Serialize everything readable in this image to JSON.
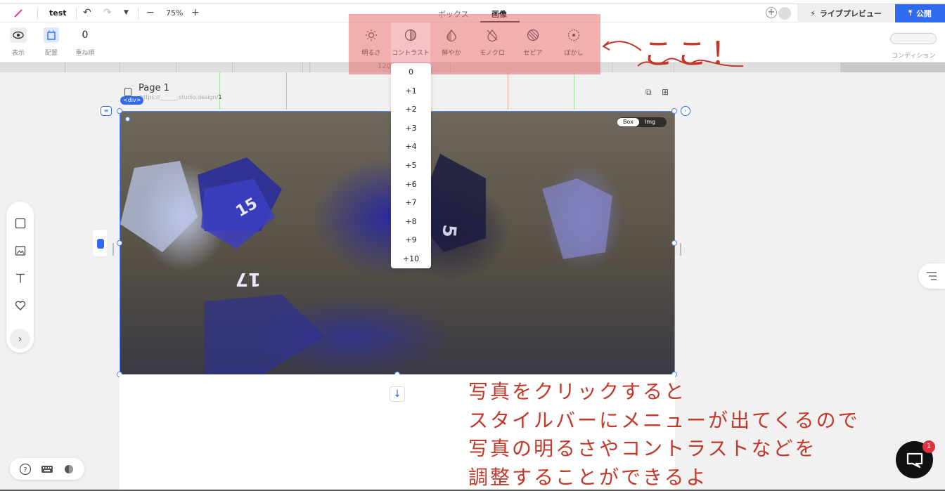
{
  "topbar": {
    "project_name": "test",
    "zoom": "75%",
    "tabs": [
      {
        "label": "ボックス",
        "active": false
      },
      {
        "label": "画像",
        "active": true
      }
    ],
    "live_preview_label": "ライブプレビュー",
    "publish_label": "公開",
    "publish_color": "#2f6bef"
  },
  "stylebar": {
    "visibility_label": "表示",
    "position_label": "配置",
    "zorder_value": "0",
    "zorder_label": "重ね順",
    "condition_label": "コンディション",
    "filters": [
      {
        "label": "明るさ",
        "icon": "sun-icon"
      },
      {
        "label": "コントラスト",
        "icon": "contrast-icon",
        "selected": true
      },
      {
        "label": "鮮やか",
        "icon": "saturation-icon"
      },
      {
        "label": "モノクロ",
        "icon": "monochrome-icon"
      },
      {
        "label": "セピア",
        "icon": "sepia-icon"
      },
      {
        "label": "ぼかし",
        "icon": "blur-icon"
      }
    ]
  },
  "ruler": {
    "marker": "120"
  },
  "page": {
    "title": "Page 1",
    "url_prefix": "https://______.studio.design/",
    "url_page": "1",
    "div_badge": "<div>",
    "toggle_box": "Box",
    "toggle_img": "Img"
  },
  "contrast_dropdown": {
    "options": [
      "0",
      "+1",
      "+2",
      "+3",
      "+4",
      "+5",
      "+6",
      "+7",
      "+8",
      "+9",
      "+10"
    ]
  },
  "chat": {
    "badge_count": "1"
  },
  "annotations": {
    "koko": "ここ！",
    "lines": [
      "写真をクリックすると",
      "スタイルバーにメニューが出てくるので",
      "写真の明るさやコントラストなどを",
      "調整することができるよ"
    ],
    "color": "#c0392b"
  }
}
